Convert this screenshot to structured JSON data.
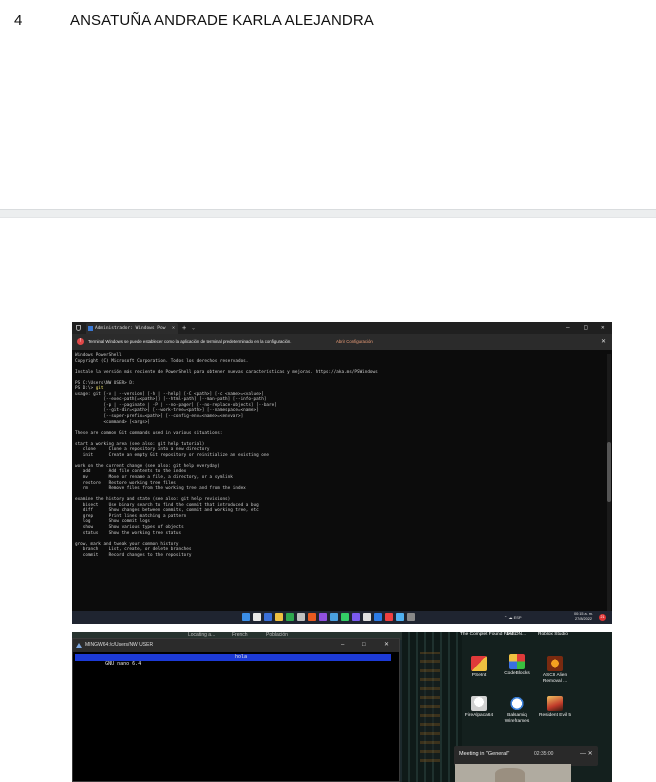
{
  "row": {
    "number": "4",
    "name": "ANSATUÑA ANDRADE KARLA ALEJANDRA"
  },
  "terminal": {
    "tab_title": "Administrador: Windows Pow",
    "new_tab": "+",
    "tab_dropdown": "⌄",
    "minimize": "–",
    "maximize": "□",
    "close": "✕",
    "info_message": "Terminal Windows se puede establecer como la aplicación de terminal predeterminado en la configuración.",
    "info_link": "Abrir Configuración",
    "lines": [
      "Windows PowerShell",
      "Copyright (C) Microsoft Corporation. Todos los derechos reservados.",
      "",
      "Instale la versión más reciente de PowerShell para obtener nuevas características y mejoras. https://aka.ms/PSWindows",
      "",
      "PS C:\\Users\\NW USER> D:",
      "PS D:\\> git",
      "usage: git [-v | --version] [-h | --help] [-C <path>] [-c <name>=<value>]",
      "           [--exec-path[=<path>]] [--html-path] [--man-path] [--info-path]",
      "           [-p | --paginate | -P | --no-pager] [--no-replace-objects] [--bare]",
      "           [--git-dir=<path>] [--work-tree=<path>] [--namespace=<name>]",
      "           [--super-prefix=<path>] [--config-env=<name>=<envvar>]",
      "           <command> [<args>]",
      "",
      "These are common Git commands used in various situations:",
      "",
      "start a working area (see also: git help tutorial)",
      "   clone     Clone a repository into a new directory",
      "   init      Create an empty Git repository or reinitialize an existing one",
      "",
      "work on the current change (see also: git help everyday)",
      "   add       Add file contents to the index",
      "   mv        Move or rename a file, a directory, or a symlink",
      "   restore   Restore working tree files",
      "   rm        Remove files from the working tree and from the index",
      "",
      "examine the history and state (see also: git help revisions)",
      "   bisect    Use binary search to find the commit that introduced a bug",
      "   diff      Show changes between commits, commit and working tree, etc",
      "   grep      Print lines matching a pattern",
      "   log       Show commit logs",
      "   show      Show various types of objects",
      "   status    Show the working tree status",
      "",
      "grow, mark and tweak your common history",
      "   branch    List, create, or delete branches",
      "   commit    Record changes to the repository"
    ],
    "taskbar": {
      "tray": "⌃ ☁ ESP",
      "time": "00:15 a. m.",
      "date": "27/8/2022",
      "notifications": "21",
      "icon_colors": [
        "#3b8ee8",
        "#e8e8e8",
        "#3a6fd8",
        "#f0c040",
        "#2fa84f",
        "#c0c0c0",
        "#e85a20",
        "#9050e0",
        "#4aa0e0",
        "#33cc66",
        "#7a5af0",
        "#e0e0e0",
        "#2c7be5",
        "#f04040",
        "#50b0f0",
        "#888888"
      ]
    }
  },
  "desktop": {
    "top_labels": [
      "Locating a...",
      "French",
      "Población"
    ],
    "mingw_title": "MINGW64:/c/Users/NW USER",
    "nano_version": "  GNU nano 6.4",
    "nano_file": "hola",
    "icon_top_labels": [
      "The Complet Found Foot...",
      "JASON...",
      "Roblox Studio"
    ],
    "icons": [
      {
        "label": "PSeInt",
        "color": "#e03a3a"
      },
      {
        "label": "CodeBlocks",
        "color": "#d84a3a"
      },
      {
        "label": "ASCII Alien Removal ...",
        "color": "#e07a20"
      },
      {
        "label": "FireAlpaca64",
        "color": "#f5f5f5"
      },
      {
        "label": "Balsamiq Wireframes",
        "color": "#f0f0f0"
      },
      {
        "label": "Resident Evil 5",
        "color": "#c03a2a"
      }
    ],
    "meeting_title": "Meeting in \"General\"",
    "meeting_time": "02:35:00",
    "meeting_ctl": "— ✕"
  }
}
